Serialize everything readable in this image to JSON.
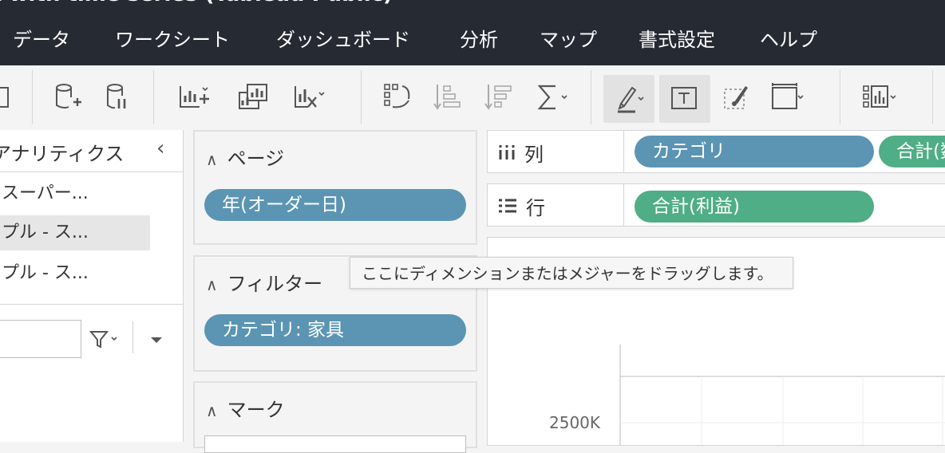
{
  "window": {
    "title": "t with time series (Tableau Public)"
  },
  "menu": [
    {
      "key": "data",
      "label": "データ"
    },
    {
      "key": "worksheet",
      "label": "ワークシート"
    },
    {
      "key": "dashboard",
      "label": "ダッシュボード"
    },
    {
      "key": "analysis",
      "label": "分析"
    },
    {
      "key": "map",
      "label": "マップ"
    },
    {
      "key": "format",
      "label": "書式設定"
    },
    {
      "key": "help",
      "label": "ヘルプ"
    }
  ],
  "left_panel": {
    "title": "アナリティクス",
    "collapse_glyph": "‹",
    "datasources": [
      "スーパー...",
      "プル - ス...",
      "プル - ス..."
    ],
    "selected_index": 1
  },
  "pages_card": {
    "title": "ページ",
    "pill": "年(オーダー日)"
  },
  "filters_card": {
    "title": "フィルター",
    "pill": "カテゴリ: 家具"
  },
  "marks_card": {
    "title": "マーク"
  },
  "columns_shelf": {
    "label": "列",
    "pills": [
      "カテゴリ",
      "合計(数"
    ]
  },
  "rows_shelf": {
    "label": "行",
    "pills": [
      "合計(利益)"
    ]
  },
  "tooltip": "ここにディメンションまたはメジャーをドラッグします。",
  "view": {
    "axis_tick": "2500K"
  },
  "colors": {
    "dimension_pill": "#5b95b3",
    "measure_pill": "#4fae85",
    "menubar_bg": "#262a33"
  }
}
